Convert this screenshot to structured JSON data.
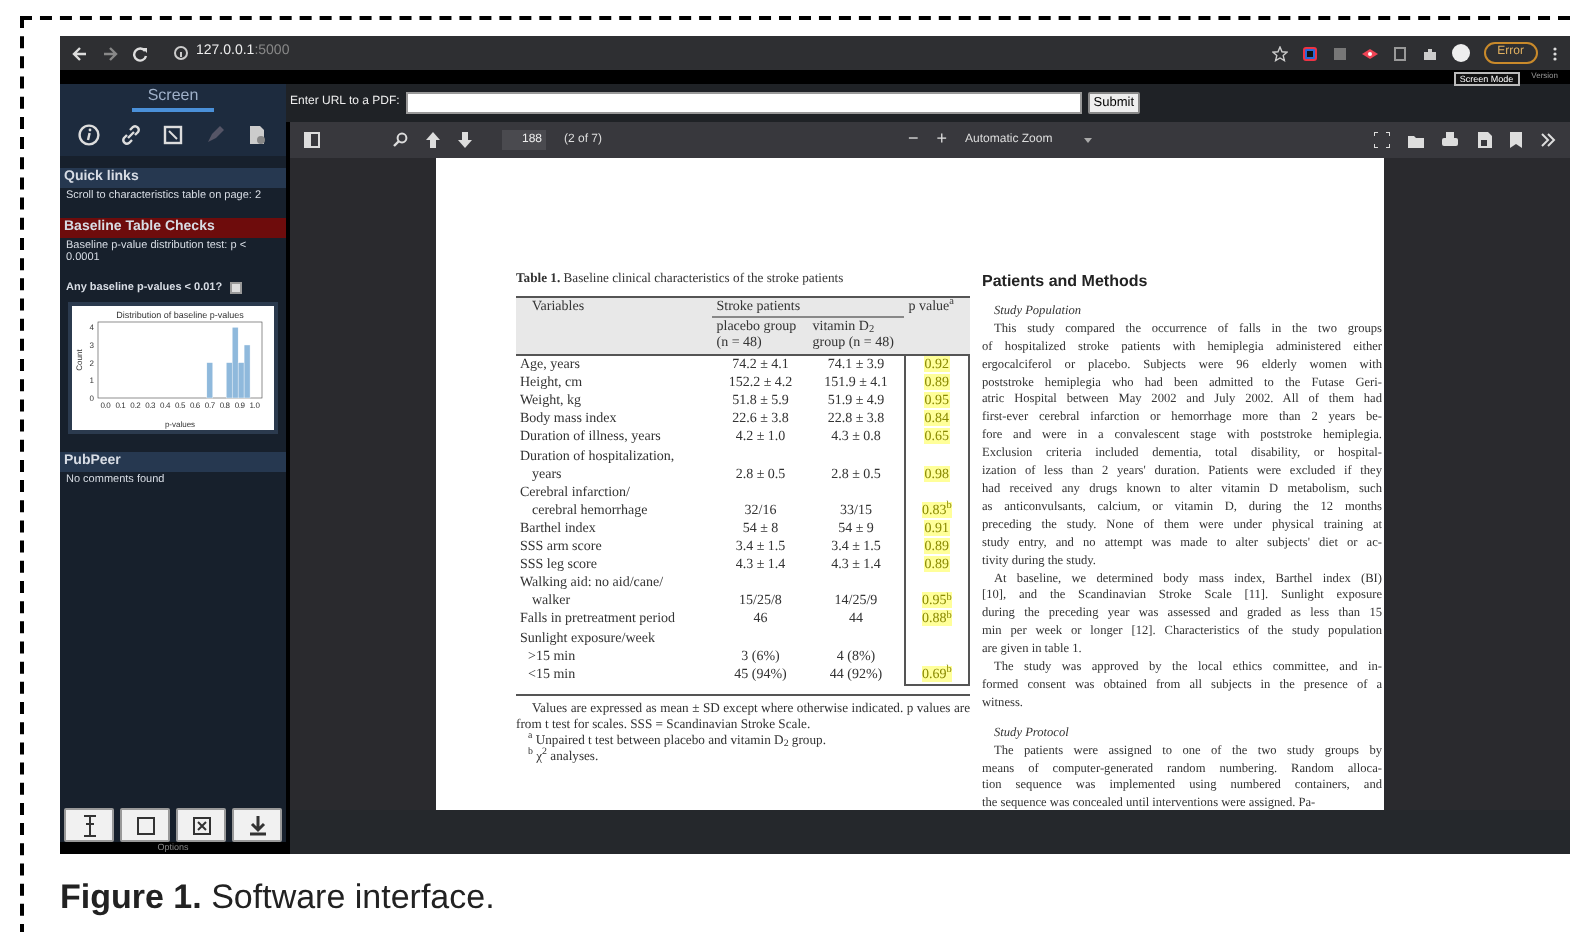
{
  "browser": {
    "host": "127.0.0.1",
    "port": ":5000",
    "profile_button": "Error"
  },
  "app_bar": {
    "mode_button": "Screen Mode",
    "version": "Version"
  },
  "sidebar": {
    "tabs": [
      {
        "label": "Screen",
        "selected": true
      }
    ],
    "sections": [
      {
        "kind": "links",
        "title": "Quick links",
        "lines": [
          "Scroll to characteristics table on page: 2"
        ]
      },
      {
        "kind": "checks",
        "title": "Baseline Table Checks",
        "lines": [
          "Baseline p-value distribution test: p < 0.0001"
        ],
        "flag": {
          "label": "Any baseline p-values < 0.01?",
          "checked": false
        },
        "chart_data": {
          "type": "bar",
          "title": "Distribution of baseline p-values",
          "xlabel": "p-values",
          "ylabel": "Count",
          "x": [
            0.7,
            0.83,
            0.87,
            0.91,
            0.95
          ],
          "values": [
            2,
            2,
            4,
            2,
            3
          ],
          "xlim": [
            -0.05,
            1.05
          ],
          "ylim": [
            0,
            4.3
          ],
          "xticks": [
            {
              "value": 0,
              "label": "0.0"
            },
            {
              "value": 0.1,
              "label": "0.1"
            },
            {
              "value": 0.2,
              "label": "0.2"
            },
            {
              "value": 0.3,
              "label": "0.3"
            },
            {
              "value": 0.4,
              "label": "0.4"
            },
            {
              "value": 0.5,
              "label": "0.5"
            },
            {
              "value": 0.6,
              "label": "0.6"
            },
            {
              "value": 0.7,
              "label": "0.7"
            },
            {
              "value": 0.8,
              "label": "0.8"
            },
            {
              "value": 0.9,
              "label": "0.9"
            },
            {
              "value": 1,
              "label": "1.0"
            }
          ],
          "yticks": [
            0,
            1,
            2,
            3,
            4
          ]
        }
      },
      {
        "kind": "links",
        "title": "PubPeer",
        "lines": [
          "No comments found"
        ]
      }
    ],
    "options_label": "Options"
  },
  "pdf_form": {
    "label": "Enter URL to a PDF:",
    "submit": "Submit"
  },
  "viewer": {
    "page_number": "188",
    "page_count": "(2 of 7)",
    "zoom_out": "−",
    "zoom_in": "+",
    "zoom": "Automatic Zoom"
  },
  "page": {
    "table": {
      "title": "**Table 1.** Baseline clinical characteristics of the stroke patients",
      "columns": [
        "Variables",
        "Stroke patients",
        "p value$^{a}$"
      ],
      "subcolumns": [
        "placebo group (n = 48)",
        "vitamin D$_{2}$ group (n = 48)"
      ],
      "rows": [
        {
          "kind": "row",
          "label": [
            "Age, years"
          ],
          "placebo": "74.2 ± 4.1",
          "vitamin": "74.1 ± 3.9",
          "p": "0.92",
          "highlighted": true
        },
        {
          "kind": "row",
          "label": [
            "Height, cm"
          ],
          "placebo": "152.2 ± 4.2",
          "vitamin": "151.9 ± 4.1",
          "p": "0.89",
          "highlighted": true
        },
        {
          "kind": "row",
          "label": [
            "Weight, kg"
          ],
          "placebo": "51.8 ± 5.9",
          "vitamin": "51.9 ± 4.9",
          "p": "0.95",
          "highlighted": true
        },
        {
          "kind": "row",
          "label": [
            "Body mass index"
          ],
          "placebo": "22.6 ± 3.8",
          "vitamin": "22.8 ± 3.8",
          "p": "0.84",
          "highlighted": true
        },
        {
          "kind": "row",
          "label": [
            "Duration of illness, years"
          ],
          "placebo": "4.2 ± 1.0",
          "vitamin": "4.3 ± 0.8",
          "p": "0.65",
          "highlighted": true
        },
        {
          "kind": "row",
          "label": [
            "Duration of hospitalization,",
            "years"
          ],
          "placebo": "2.8 ± 0.5",
          "vitamin": "2.8 ± 0.5",
          "p": "0.98",
          "highlighted": true
        },
        {
          "kind": "row",
          "label": [
            "Cerebral infarction/",
            "cerebral hemorrhage"
          ],
          "placebo": "32/16",
          "vitamin": "33/15",
          "p": "0.83$^{b}$",
          "highlighted": true
        },
        {
          "kind": "row",
          "label": [
            "Barthel index"
          ],
          "placebo": "54 ± 8",
          "vitamin": "54 ± 9",
          "p": "0.91",
          "highlighted": true
        },
        {
          "kind": "row",
          "label": [
            "SSS arm score"
          ],
          "placebo": "3.4 ± 1.5",
          "vitamin": "3.4 ± 1.5",
          "p": "0.89",
          "highlighted": true
        },
        {
          "kind": "row",
          "label": [
            "SSS leg score"
          ],
          "placebo": "4.3 ± 1.4",
          "vitamin": "4.3 ± 1.4",
          "p": "0.89",
          "highlighted": true
        },
        {
          "kind": "row",
          "label": [
            "Walking aid: no aid/cane/",
            "walker"
          ],
          "placebo": "15/25/8",
          "vitamin": "14/25/9",
          "p": "0.95$^{b}$",
          "highlighted": true
        },
        {
          "kind": "row",
          "label": [
            "Falls in pretreatment period"
          ],
          "placebo": "46",
          "vitamin": "44",
          "p": "0.88$^{b}$",
          "highlighted": true
        },
        {
          "kind": "group",
          "label": [
            "Sunlight exposure/week"
          ]
        },
        {
          "kind": "sub",
          "label": [
            ">15 min"
          ],
          "placebo": "3 (6%)",
          "vitamin": "4 (8%)"
        },
        {
          "kind": "sub",
          "label": [
            "<15 min"
          ],
          "placebo": "45 (94%)",
          "vitamin": "44 (92%)",
          "p": "0.69$^{b}$",
          "highlighted": true
        }
      ],
      "note": "Values are expressed as mean ± SD except where otherwise indicated. p values are from t test for scales. SSS = Scandinavian Stroke Scale.",
      "footnotes": [
        "$^{a}$ Unpaired t test between placebo and vitamin D$_{2}$ group.",
        "$^{b}$ χ$^{2}$ analyses."
      ]
    },
    "article": {
      "heading": "Patients and Methods",
      "blocks": [
        {
          "kind": "subheading",
          "text": "Study Population"
        },
        {
          "kind": "paragraph",
          "lines": [
            "This study compared the occurrence of falls in the two groups",
            "of hospitalized stroke patients with hemiplegia administered either",
            "ergocalciferol or placebo. Subjects were 96 elderly women with",
            "poststroke hemiplegia who had been admitted to the Futase Geri-",
            "atric Hospital between May 2002 and July 2002. All of them had",
            "first-ever cerebral infarction or hemorrhage more than 2 years be-",
            "fore and were in a convalescent stage with poststroke hemiplegia.",
            "Exclusion criteria included dementia, total disability, or hospital-",
            "ization of less than 2 years' duration. Patients were excluded if they",
            "had received any drugs known to alter vitamin D metabolism, such",
            "as anticonvulsants, calcium, or vitamin D, during the 12 months",
            "preceding the study. None of them were under physical training at",
            "study entry, and no attempt was made to alter subjects' diet or ac-",
            "tivity during the study."
          ]
        },
        {
          "kind": "paragraph",
          "lines": [
            "At baseline, we determined body mass index, Barthel index (BI)",
            "[10], and the Scandinavian Stroke Scale [11]. Sunlight exposure",
            "during the preceding year was assessed and graded as less than 15",
            "min per week or longer [12]. Characteristics of the study population",
            "are given in table 1."
          ]
        },
        {
          "kind": "paragraph",
          "lines": [
            "The study was approved by the local ethics committee, and in-",
            "formed consent was obtained from all subjects in the presence of a",
            "witness."
          ]
        },
        {
          "kind": "subheading",
          "text": "Study Protocol"
        },
        {
          "kind": "paragraph",
          "lines": [
            "The patients were assigned to one of the two study groups by",
            "means of computer-generated random numbering. Random alloca-",
            "tion sequence was implemented using numbered containers, and",
            "the sequence was concealed until interventions were assigned. Pa-"
          ]
        }
      ]
    }
  },
  "caption": {
    "text": "**Figure 1.** Software interface."
  }
}
